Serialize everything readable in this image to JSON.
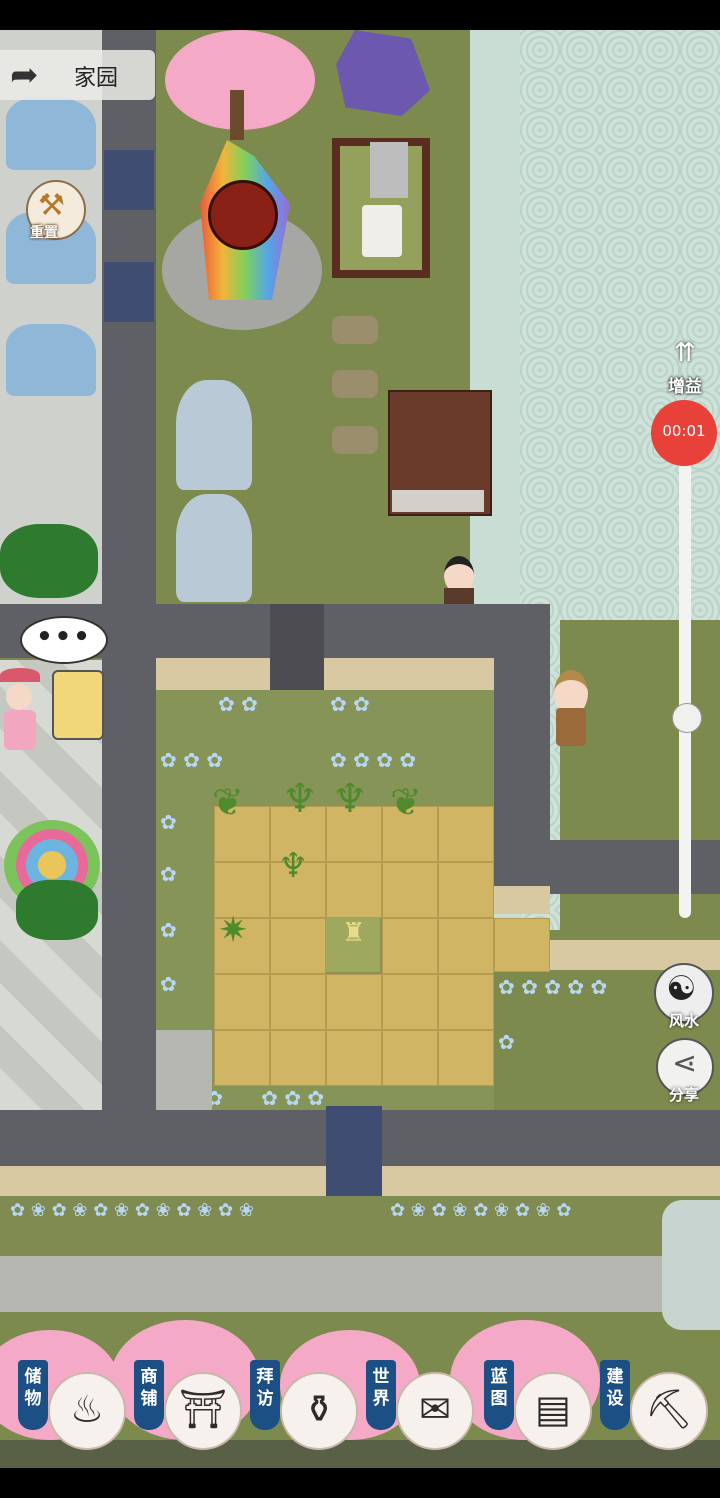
{
  "header": {
    "back_label": "家园"
  },
  "left_tools": {
    "reset_label": "重置"
  },
  "right_tools": {
    "buff_label": "增益",
    "timer": "00:01",
    "fengshui_label": "风水",
    "share_label": "分享"
  },
  "chat_bubble": {
    "text": "•••"
  },
  "bottom_nav": [
    {
      "label": "储物",
      "icon": "bag-icon"
    },
    {
      "label": "商铺",
      "icon": "shop-icon"
    },
    {
      "label": "拜访",
      "icon": "visit-icon"
    },
    {
      "label": "世界",
      "icon": "scroll-map-icon"
    },
    {
      "label": "蓝图",
      "icon": "blueprint-icon"
    },
    {
      "label": "建设",
      "icon": "pickaxe-icon"
    }
  ]
}
